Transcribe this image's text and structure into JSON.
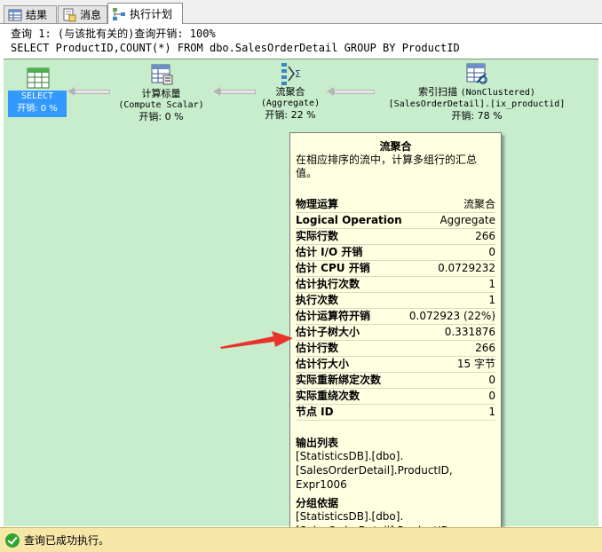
{
  "tabs": [
    {
      "label": "结果",
      "icon": "grid-icon"
    },
    {
      "label": "消息",
      "icon": "message-icon"
    },
    {
      "label": "执行计划",
      "icon": "plan-icon",
      "active": true
    }
  ],
  "query": {
    "line1": "查询 1: (与该批有关的)查询开销: 100%",
    "line2": "SELECT ProductID,COUNT(*) FROM dbo.SalesOrderDetail GROUP BY ProductID"
  },
  "nodes": {
    "select": {
      "label": "SELECT",
      "cost": "开销: 0 %"
    },
    "compute": {
      "label": "计算标量",
      "sub": "(Compute Scalar)",
      "cost": "开销: 0 %"
    },
    "aggregate": {
      "label": "流聚合",
      "sub": "(Aggregate)",
      "cost": "开销: 22 %"
    },
    "index": {
      "label": "索引扫描",
      "label_note": "(NonClustered)",
      "sub": "[SalesOrderDetail].[ix_productid]",
      "cost": "开销: 78 %"
    }
  },
  "tooltip": {
    "title": "流聚合",
    "description": "在相应排序的流中，计算多组行的汇总值。",
    "rows": [
      {
        "k": "物理运算",
        "v": "流聚合"
      },
      {
        "k": "Logical Operation",
        "v": "Aggregate"
      },
      {
        "k": "实际行数",
        "v": "266"
      },
      {
        "k": "估计 I/O 开销",
        "v": "0"
      },
      {
        "k": "估计 CPU 开销",
        "v": "0.0729232"
      },
      {
        "k": "估计执行次数",
        "v": "1"
      },
      {
        "k": "执行次数",
        "v": "1"
      },
      {
        "k": "估计运算符开销",
        "v": "0.072923 (22%)"
      },
      {
        "k": "估计子树大小",
        "v": "0.331876"
      },
      {
        "k": "估计行数",
        "v": "266"
      },
      {
        "k": "估计行大小",
        "v": "15 字节"
      },
      {
        "k": "实际重新绑定次数",
        "v": "0"
      },
      {
        "k": "实际重绕次数",
        "v": "0"
      },
      {
        "k": "节点 ID",
        "v": "1"
      }
    ],
    "output_title": "输出列表",
    "output_lines": [
      "[StatisticsDB].[dbo].",
      "[SalesOrderDetail].ProductID,",
      "Expr1006"
    ],
    "group_title": "分组依据",
    "group_lines": [
      "[StatisticsDB].[dbo].",
      "[SalesOrderDetail].ProductID"
    ]
  },
  "status": {
    "text": "查询已成功执行。"
  },
  "colors": {
    "canvas": "#c7edcc",
    "tooltip": "#ffffe1",
    "status": "#f6e7a9",
    "select_highlight": "#3399ff",
    "annotation": "#e8322a"
  }
}
